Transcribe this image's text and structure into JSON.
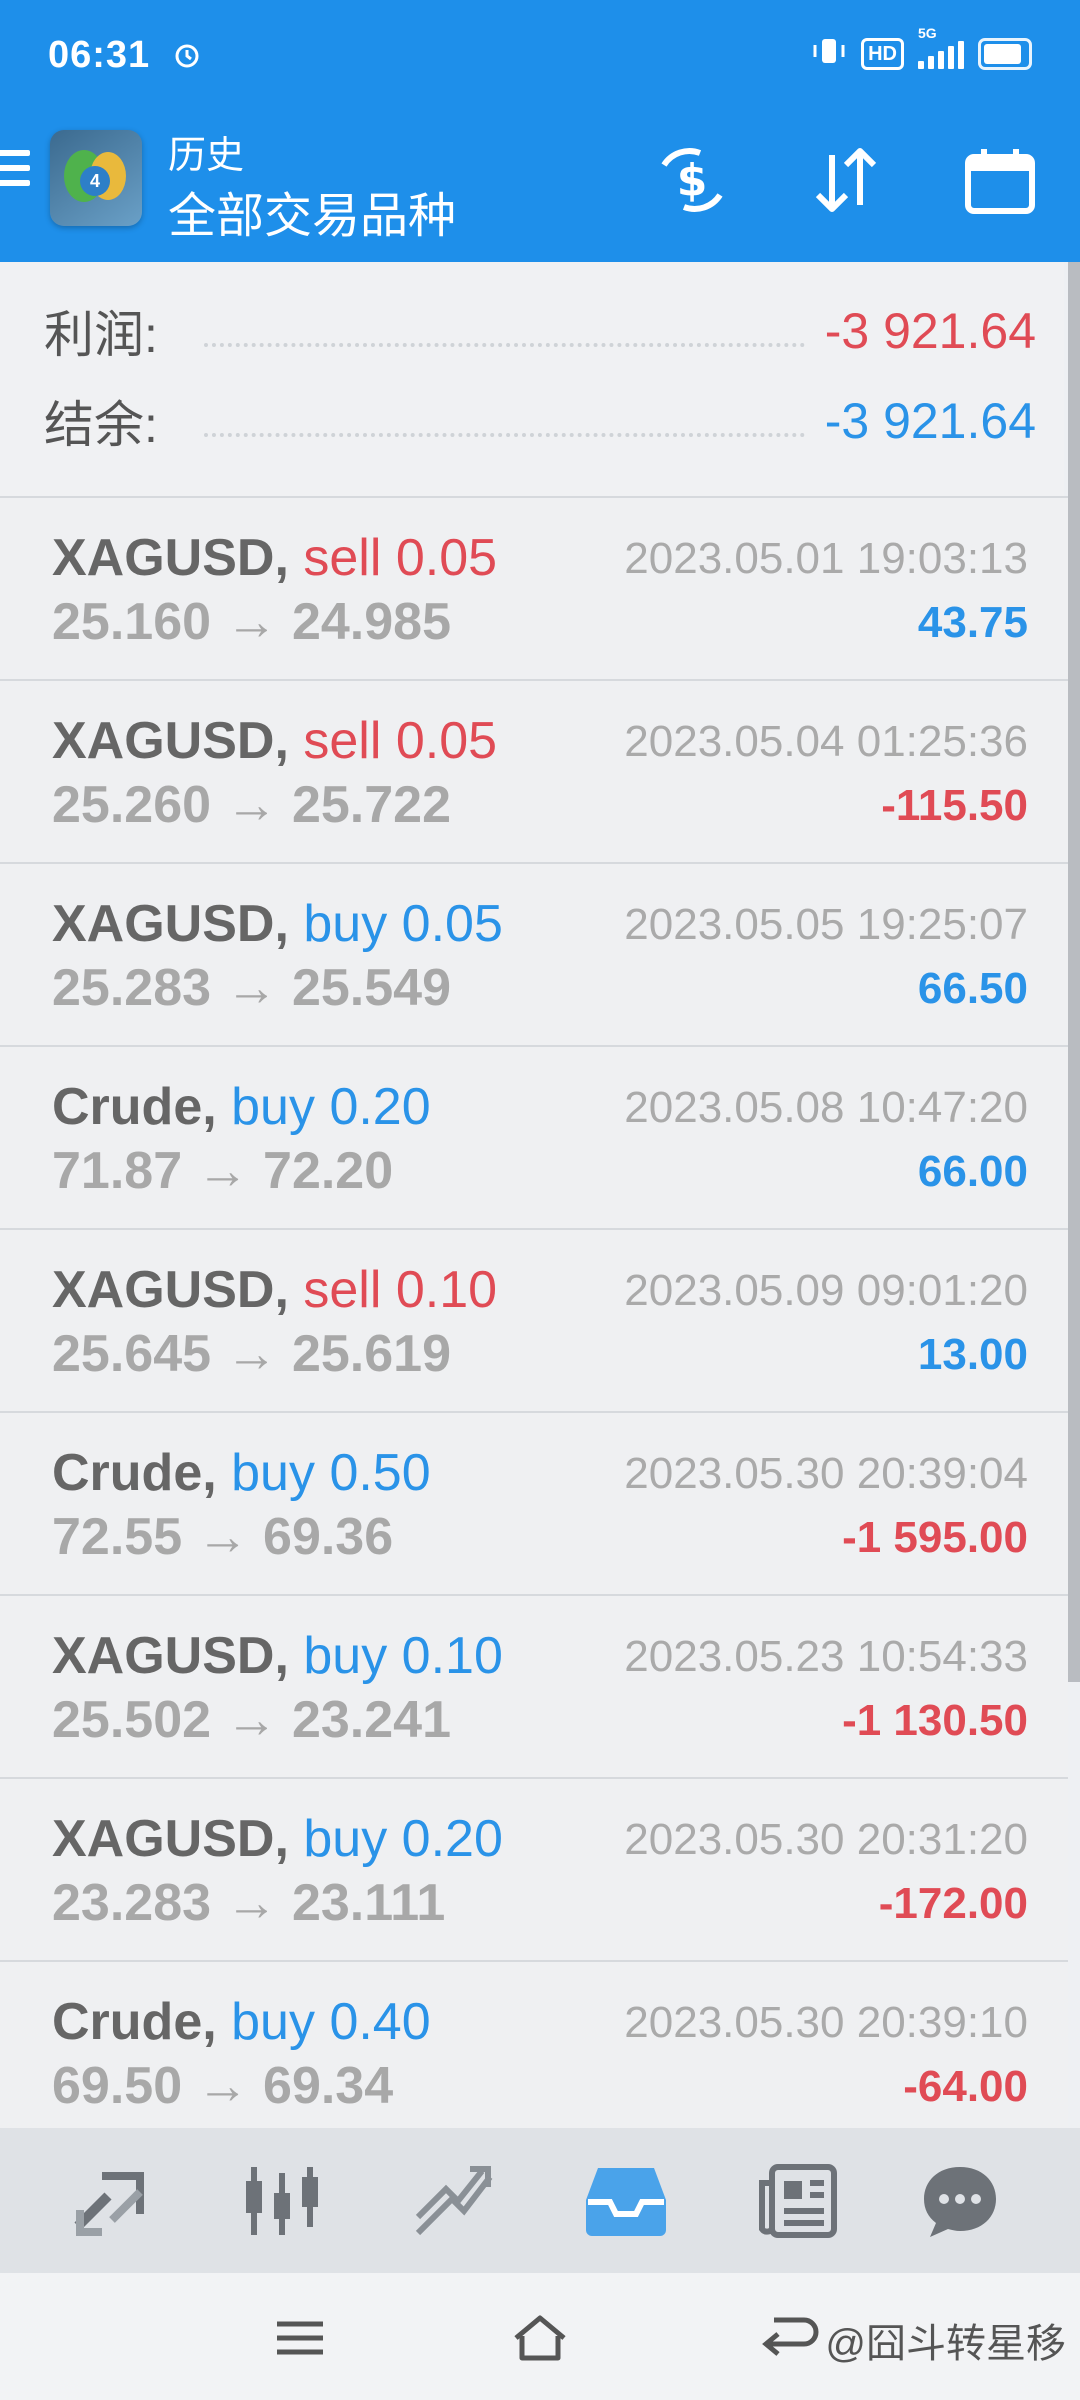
{
  "status_bar": {
    "time": "06:31",
    "network": "HD",
    "signal_label": "5G"
  },
  "header": {
    "subtitle": "历史",
    "title": "全部交易品种",
    "icons": [
      "menu-icon",
      "metatrader-logo",
      "dollar-refresh-icon",
      "sort-icon",
      "calendar-icon"
    ]
  },
  "summary": {
    "profit_label": "利润:",
    "profit_value": "-3 921.64",
    "balance_label": "结余:",
    "balance_value": "-3 921.64"
  },
  "trades": [
    {
      "symbol": "XAGUSD,",
      "side": "sell",
      "volume": "0.05",
      "prices": "25.160 → 24.985",
      "time": "2023.05.01 19:03:13",
      "profit": "43.75"
    },
    {
      "symbol": "XAGUSD,",
      "side": "sell",
      "volume": "0.05",
      "prices": "25.260 → 25.722",
      "time": "2023.05.04 01:25:36",
      "profit": "-115.50"
    },
    {
      "symbol": "XAGUSD,",
      "side": "buy",
      "volume": "0.05",
      "prices": "25.283 → 25.549",
      "time": "2023.05.05 19:25:07",
      "profit": "66.50"
    },
    {
      "symbol": "Crude,",
      "side": "buy",
      "volume": "0.20",
      "prices": "71.87 → 72.20",
      "time": "2023.05.08 10:47:20",
      "profit": "66.00"
    },
    {
      "symbol": "XAGUSD,",
      "side": "sell",
      "volume": "0.10",
      "prices": "25.645 → 25.619",
      "time": "2023.05.09 09:01:20",
      "profit": "13.00"
    },
    {
      "symbol": "Crude,",
      "side": "buy",
      "volume": "0.50",
      "prices": "72.55 → 69.36",
      "time": "2023.05.30 20:39:04",
      "profit": "-1 595.00"
    },
    {
      "symbol": "XAGUSD,",
      "side": "buy",
      "volume": "0.10",
      "prices": "25.502 → 23.241",
      "time": "2023.05.23 10:54:33",
      "profit": "-1 130.50"
    },
    {
      "symbol": "XAGUSD,",
      "side": "buy",
      "volume": "0.20",
      "prices": "23.283 → 23.111",
      "time": "2023.05.30 20:31:20",
      "profit": "-172.00"
    },
    {
      "symbol": "Crude,",
      "side": "buy",
      "volume": "0.40",
      "prices": "69.50 → 69.34",
      "time": "2023.05.30 20:39:10",
      "profit": "-64.00"
    }
  ],
  "bottom_nav": {
    "items": [
      "quotes-icon",
      "chart-icon",
      "trade-icon",
      "history-icon",
      "news-icon",
      "chat-icon"
    ],
    "active": "history-icon"
  },
  "system_nav": {
    "watermark": "@囧斗转星移"
  },
  "colors": {
    "header_bg": "#1e8fea",
    "buy": "#2a93e8",
    "sell": "#e04b55"
  }
}
